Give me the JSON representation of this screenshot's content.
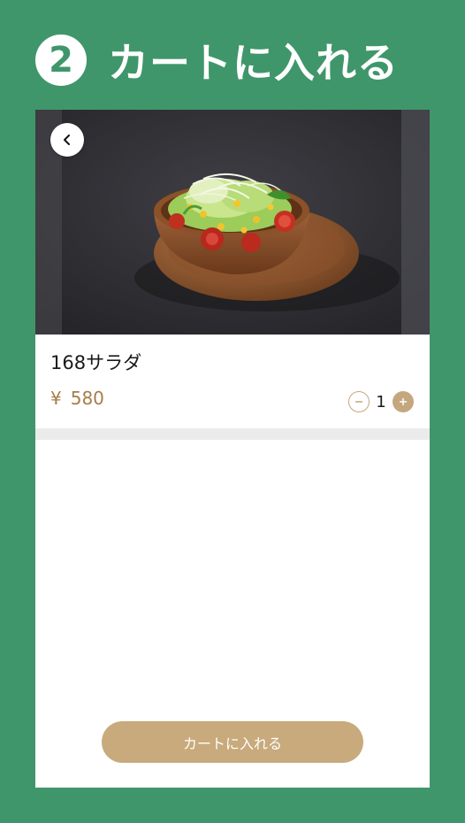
{
  "header": {
    "step_number": "2",
    "title": "カートに入れる"
  },
  "product": {
    "name": "168サラダ",
    "price_currency": "¥",
    "price_value": "580",
    "quantity": "1"
  },
  "actions": {
    "add_to_cart_label": "カートに入れる"
  },
  "colors": {
    "background_green": "#40966b",
    "accent_gold": "#c8aa7c",
    "price_text": "#a57d48"
  },
  "icons": {
    "back": "chevron-left-icon",
    "decrease": "minus-icon",
    "increase": "plus-icon"
  }
}
